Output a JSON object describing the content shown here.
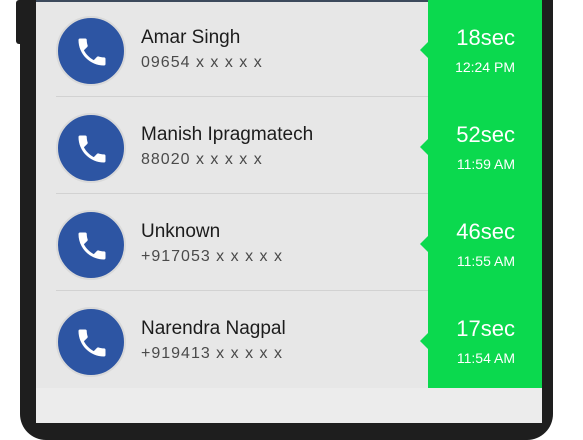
{
  "calls": [
    {
      "name": "Amar Singh",
      "number": "09654 x x x x x",
      "duration": "18sec",
      "time": "12:24 PM"
    },
    {
      "name": "Manish Ipragmatech",
      "number": "88020 x x x x x",
      "duration": "52sec",
      "time": "11:59 AM"
    },
    {
      "name": "Unknown",
      "number": "+917053 x x x x x",
      "duration": "46sec",
      "time": "11:55 AM"
    },
    {
      "name": "Narendra Nagpal",
      "number": "+919413 x x x x x",
      "duration": "17sec",
      "time": "11:54 AM"
    }
  ],
  "colors": {
    "avatar": "#2d55a3",
    "duration_panel": "#0bd94e",
    "row_background": "#e7e7e7"
  },
  "icons": {
    "avatar": "phone-handset-icon"
  }
}
